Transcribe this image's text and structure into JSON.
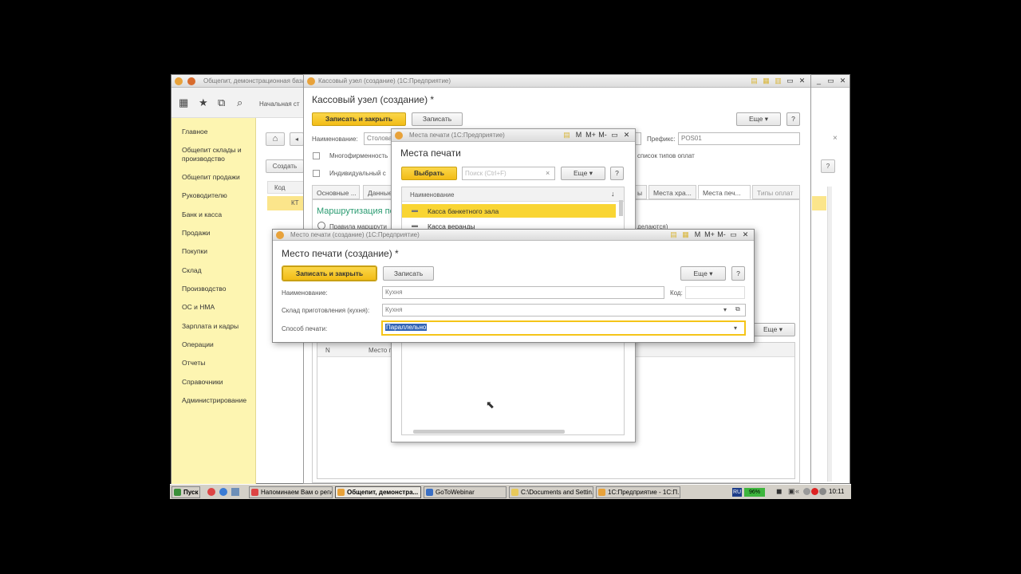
{
  "main_window": {
    "title": "Общепит, демонстрационная база / ...",
    "start_page": "Начальная ст",
    "toolbar_icons": [
      "apps-icon",
      "star-icon",
      "history-icon",
      "search-icon"
    ],
    "sidebar": [
      "Главное",
      "Общепит склады и производство",
      "Общепит продажи",
      "Руководителю",
      "Банк и касса",
      "Продажи",
      "Покупки",
      "Склад",
      "Производство",
      "ОС и НМА",
      "Зарплата и кадры",
      "Операции",
      "Отчеты",
      "Справочники",
      "Администрирование"
    ],
    "list_create": "Создать",
    "list_col_code": "Код",
    "list_row_code": "КТ"
  },
  "kassa": {
    "titlebar": "Кассовый узел (создание) (1С:Предприятие)",
    "title": "Кассовый узел (создание) *",
    "save_close": "Записать и закрыть",
    "save": "Записать",
    "more": "Еще",
    "help": "?",
    "name_label": "Наименование:",
    "name_value": "Столовая",
    "prefix_label": "Префикс:",
    "prefix_value": "POS01",
    "multi_company": "Многофирменность",
    "individual": "Индивидуальный с",
    "payment_types_note": "список типов оплат",
    "tabs": [
      "Основные ...",
      "Данные",
      "ы",
      "Места хра...",
      "Места печ...",
      "Типы оплат"
    ],
    "routing_header": "Маршрутизация пе",
    "routing_rule": "Правила маршрути",
    "routing_note": "делаются)",
    "table_more": "Еще",
    "col_n": "N",
    "col_place": "Место п"
  },
  "mesta": {
    "titlebar": "Места печати (1С:Предприятие)",
    "title": "Места печати",
    "select": "Выбрать",
    "search_placeholder": "Поиск (Ctrl+F)",
    "more": "Еще",
    "help": "?",
    "col_name": "Наименование",
    "rows": [
      "Касса банкетного зала",
      "Касса веранды"
    ]
  },
  "mesto": {
    "titlebar": "Место печати (создание) (1С:Предприятие)",
    "title": "Место печати (создание) *",
    "save_close": "Записать и закрыть",
    "save": "Записать",
    "more": "Еще",
    "help": "?",
    "name_label": "Наименование:",
    "name_value": "Кухня",
    "code_label": "Код:",
    "code_value": "",
    "warehouse_label": "Склад приготовления (кухня):",
    "warehouse_value": "Кухня",
    "print_label": "Способ печати:",
    "print_value": "Параллельно"
  },
  "taskbar": {
    "start": "Пуск",
    "items": [
      "Напоминаем Вам о реги...",
      "Общепит, демонстра...",
      "GoToWebinar",
      "C:\\Documents and Settin...",
      "1С:Предприятие - 1С:П..."
    ],
    "lang": "RU",
    "battery": "96%",
    "clock": "10:11"
  },
  "colors": {
    "accent_yellow": "#f5c518",
    "sidebar_bg": "#fdf5b1",
    "selected_row": "#f9d533",
    "link_green": "#2a9b71"
  }
}
